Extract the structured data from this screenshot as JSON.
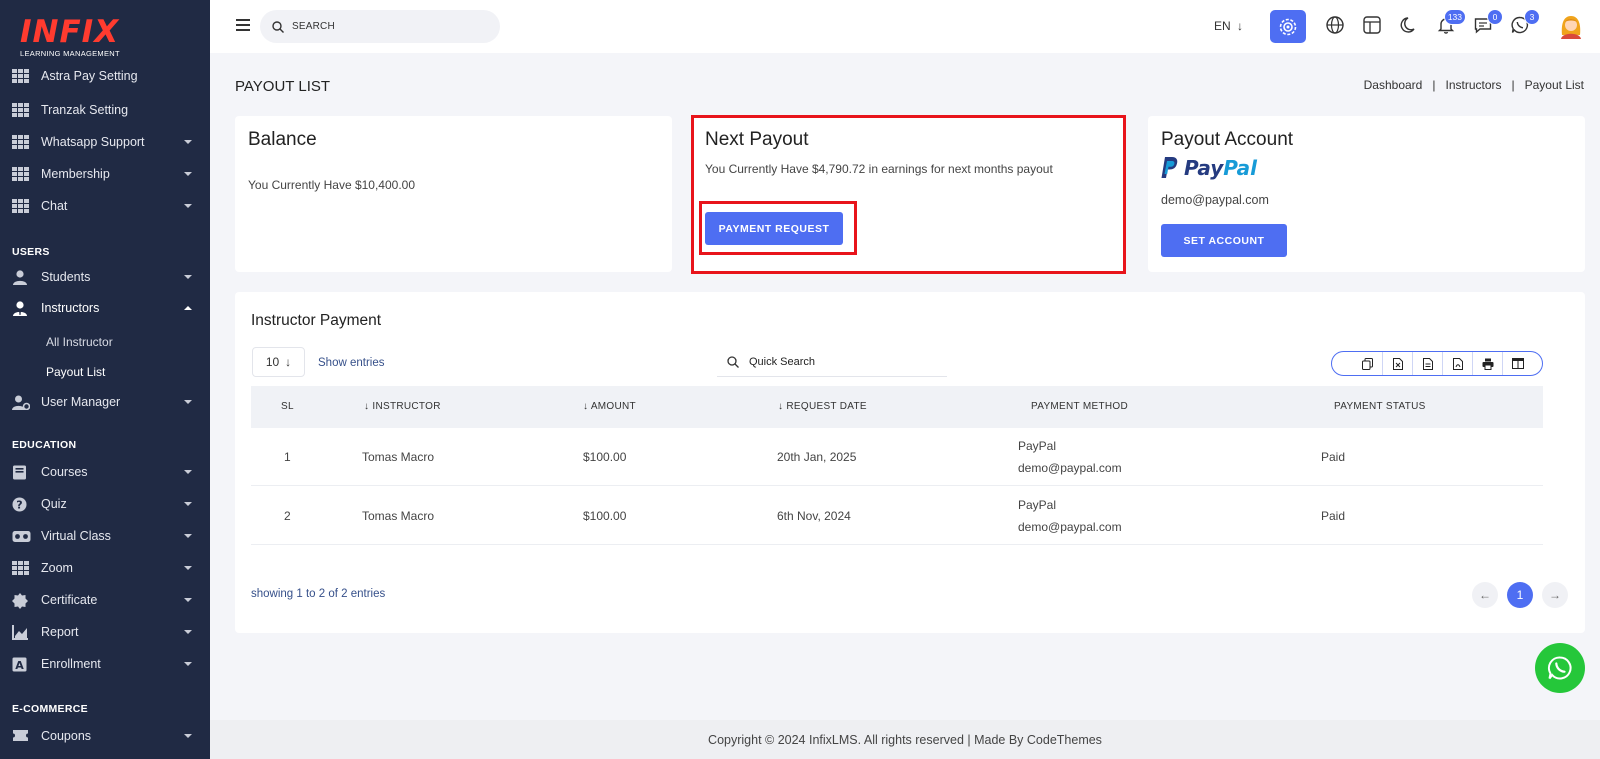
{
  "logo": {
    "main": "INFIX",
    "sub": "LEARNING MANAGEMENT"
  },
  "sidebar": {
    "items": [
      {
        "label": "Astra Pay Setting"
      },
      {
        "label": "Tranzak Setting"
      },
      {
        "label": "Whatsapp Support"
      },
      {
        "label": "Membership"
      },
      {
        "label": "Chat"
      },
      {
        "label": "Students"
      },
      {
        "label": "Instructors"
      },
      {
        "label": "User Manager"
      },
      {
        "label": "Courses"
      },
      {
        "label": "Quiz"
      },
      {
        "label": "Virtual Class"
      },
      {
        "label": "Zoom"
      },
      {
        "label": "Certificate"
      },
      {
        "label": "Report"
      },
      {
        "label": "Enrollment"
      },
      {
        "label": "Coupons"
      }
    ],
    "sections": {
      "users": "USERS",
      "education": "EDUCATION",
      "ecommerce": "E-COMMERCE"
    },
    "sub_items": {
      "all_instructor": "All Instructor",
      "payout_list": "Payout List"
    }
  },
  "topbar": {
    "search_placeholder": "SEARCH",
    "language": "EN",
    "badges": {
      "notifications": "133",
      "messages": "0",
      "whatsapp": "3"
    }
  },
  "page": {
    "title": "PAYOUT LIST",
    "breadcrumb": [
      "Dashboard",
      "Instructors",
      "Payout List"
    ]
  },
  "balance_card": {
    "title": "Balance",
    "text": "You Currently Have $10,400.00"
  },
  "next_payout_card": {
    "title": "Next Payout",
    "text": "You Currently Have $4,790.72 in earnings for next months payout",
    "button": "PAYMENT REQUEST"
  },
  "payout_account_card": {
    "title": "Payout Account",
    "logo_pay": "Pay",
    "logo_pal": "Pal",
    "email": "demo@paypal.com",
    "button": "SET ACCOUNT"
  },
  "table": {
    "title": "Instructor Payment",
    "entries_value": "10",
    "show_entries": "Show entries",
    "quick_search": "Quick Search",
    "headers": {
      "sl": "SL",
      "instructor": "INSTRUCTOR",
      "amount": "AMOUNT",
      "request_date": "REQUEST DATE",
      "payment_method": "PAYMENT METHOD",
      "payment_status": "PAYMENT STATUS"
    },
    "rows": [
      {
        "sl": "1",
        "instructor": "Tomas Macro",
        "amount": "$100.00",
        "date": "20th Jan, 2025",
        "method": "PayPal",
        "email": "demo@paypal.com",
        "status": "Paid"
      },
      {
        "sl": "2",
        "instructor": "Tomas Macro",
        "amount": "$100.00",
        "date": "6th Nov, 2024",
        "method": "PayPal",
        "email": "demo@paypal.com",
        "status": "Paid"
      }
    ],
    "showing": "showing 1 to 2 of 2 entries",
    "current_page": "1"
  },
  "footer": {
    "text": "Copyright © 2024 InfixLMS. All rights reserved | Made By CodeThemes"
  },
  "colors": {
    "accent": "#4e6ef2",
    "sidebar": "#202a44",
    "highlight": "#e8141b",
    "whatsapp": "#25c73a"
  }
}
